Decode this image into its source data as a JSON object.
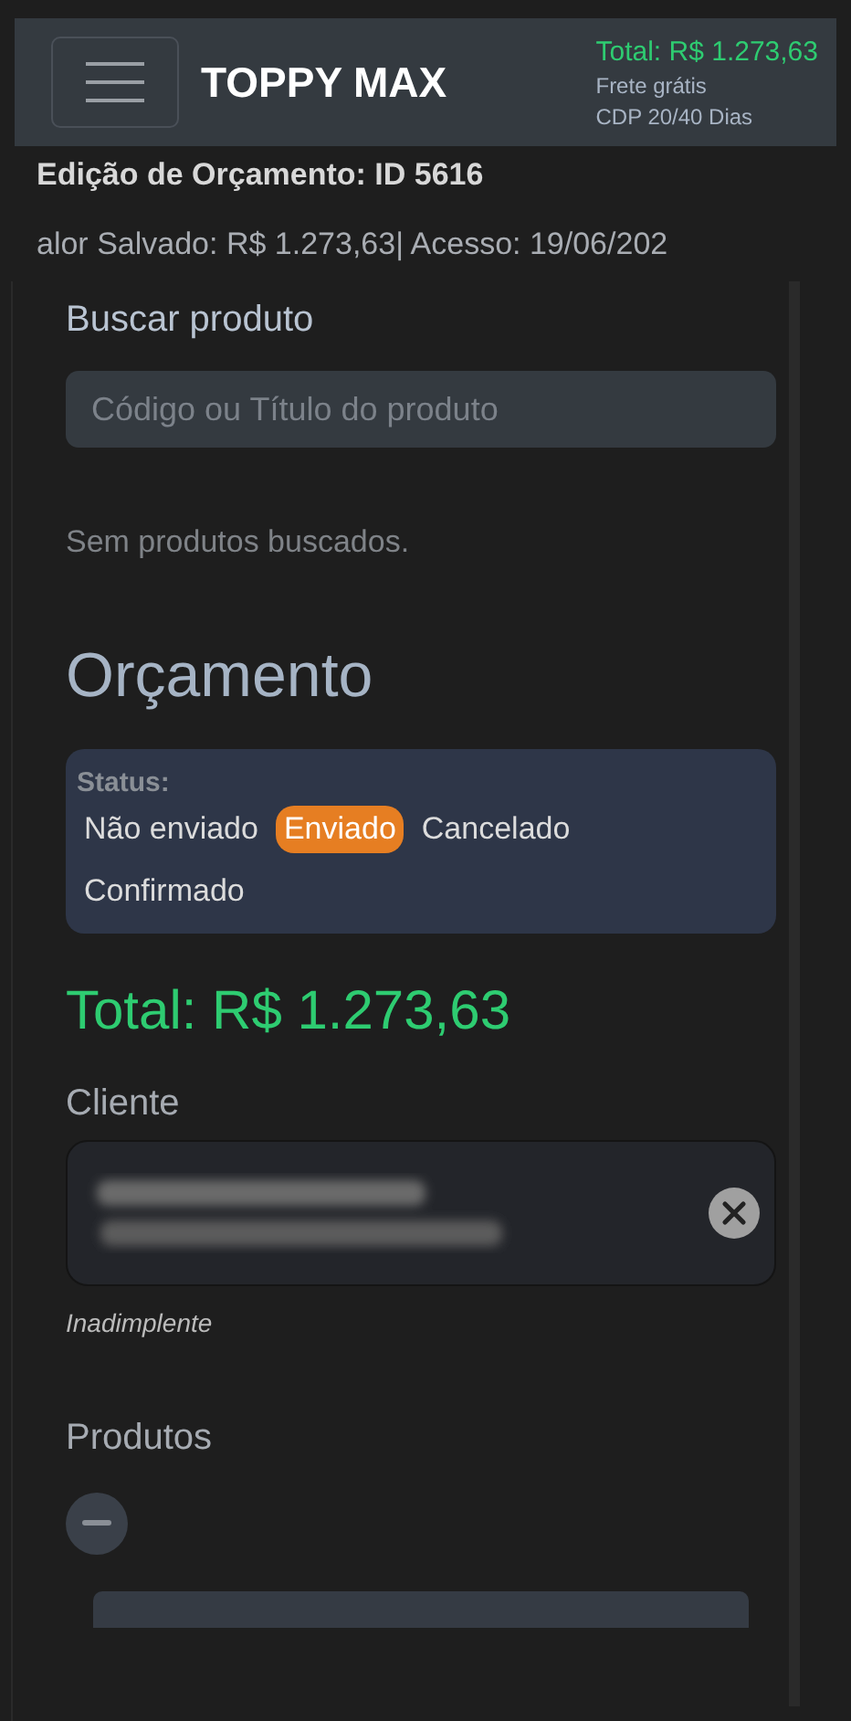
{
  "header": {
    "brand": "TOPPY MAX",
    "total": "Total: R$ 1.273,63",
    "shipping": "Frete grátis",
    "payment_terms": "CDP 20/40 Dias"
  },
  "page_title": "Edição de Orçamento: ID 5616",
  "info_line": "alor Salvado: R$ 1.273,63|  Acesso: 19/06/202",
  "search": {
    "label": "Buscar produto",
    "placeholder": "Código ou Título do produto",
    "empty_message": "Sem produtos buscados."
  },
  "budget": {
    "heading": "Orçamento",
    "status_label": "Status:",
    "statuses": [
      {
        "label": "Não enviado",
        "selected": false
      },
      {
        "label": "Enviado",
        "selected": true
      },
      {
        "label": "Cancelado",
        "selected": false
      },
      {
        "label": "Confirmado",
        "selected": false
      }
    ],
    "total": "Total: R$ 1.273,63",
    "client_label": "Cliente",
    "client_note": "Inadimplente",
    "products_label": "Produtos"
  }
}
